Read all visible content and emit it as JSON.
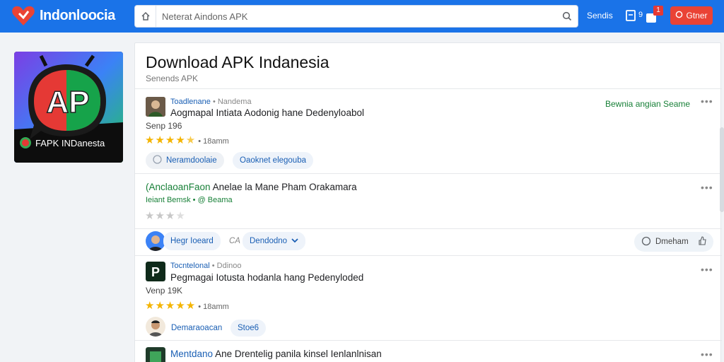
{
  "header": {
    "logo_text": "Indonloocia",
    "search_placeholder": "Neterat Aindons APK",
    "link_label": "Sendis",
    "count_label": "9",
    "badge_count": "1",
    "button_label": "Gtner"
  },
  "sidebar": {
    "tile_label": "FAPK INDanesta",
    "tile_mark": "AP"
  },
  "main": {
    "title": "Download APK Indanesia",
    "subtitle": "Senends APK",
    "posts": [
      {
        "author": "Toadlenane",
        "meta_extra": "• Nandema",
        "title": "Aogmapal Intiata Aodonig hane Dedenyloabol",
        "size": "Senp  196",
        "stars": 4.5,
        "rating_count": "• 18amm",
        "side_link": "Bewnia angian  Seame",
        "chips": [
          "Neramdoolaie",
          "Oaoknet elegouba"
        ]
      },
      {
        "author": "AnclaoanFaon",
        "title": "Anclaoan Faon Anelae la Mane Pham Orakamara",
        "title_lead": "(AnclaoanFaon",
        "title_rest": "Anelae la Mane Pham Orakamara",
        "meta": "Ieiant Bemsk",
        "meta_extra": "• @ Beama",
        "stars": 1.5,
        "chips": [
          "Hegr Ioeard",
          "Dendodno"
        ],
        "chip_sep": "CA",
        "side_chip": "Dmeham"
      },
      {
        "author": "Tocntelonal",
        "meta_extra": "• Ddinoo",
        "title": "Pegmagai Iotusta hodanla hang Pedenyloded",
        "size": "Venp  19K",
        "stars": 5,
        "rating_count": "• 18amm",
        "chips": [
          "Demaraoacan",
          "Stoe6"
        ]
      },
      {
        "author": "Mentdano",
        "title": "Ane Drentelig panila kinsel Ienlanlnisan"
      }
    ]
  },
  "colors": {
    "brand_blue": "#1a73e8",
    "accent_red": "#ea4335",
    "link_blue": "#1a5fb4",
    "green": "#188038",
    "star": "#f4b400"
  }
}
